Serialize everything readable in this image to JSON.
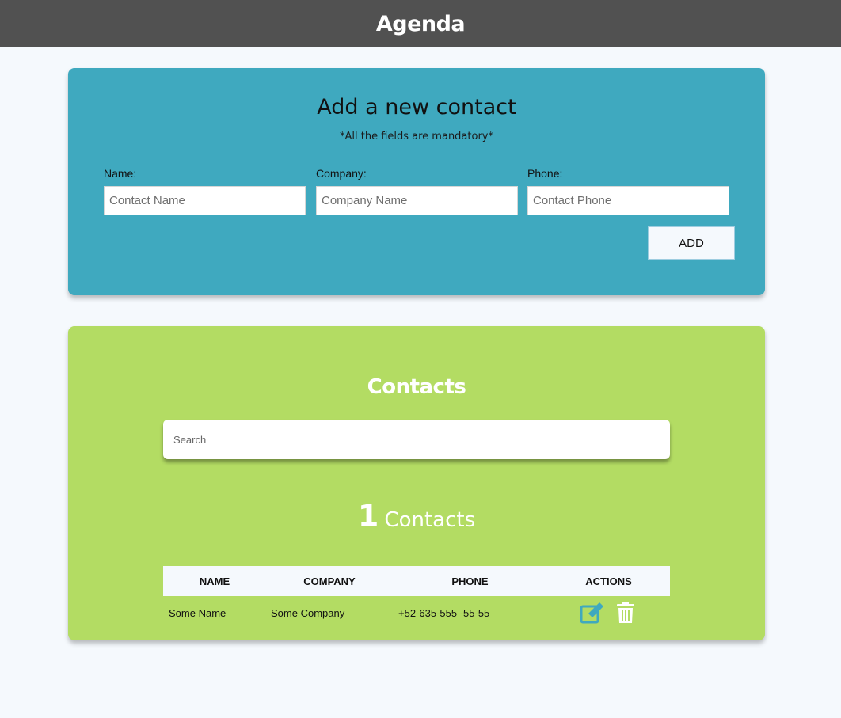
{
  "header": {
    "title": "Agenda"
  },
  "add_form": {
    "title": "Add a new contact",
    "subtitle": "*All the fields are mandatory*",
    "name_label": "Name:",
    "name_placeholder": "Contact Name",
    "company_label": "Company:",
    "company_placeholder": "Company Name",
    "phone_label": "Phone:",
    "phone_placeholder": "Contact Phone",
    "add_button": "ADD"
  },
  "contacts": {
    "title": "Contacts",
    "search_placeholder": "Search",
    "count": "1",
    "count_label": "Contacts",
    "columns": [
      "NAME",
      "COMPANY",
      "PHONE",
      "ACTIONS"
    ],
    "rows": [
      {
        "name": "Some Name",
        "company": "Some Company",
        "phone": "+52-635-555 -55-55"
      }
    ],
    "actions": {
      "edit_icon": "edit-icon",
      "delete_icon": "trash-icon"
    }
  },
  "colors": {
    "topbar": "#515151",
    "add_card": "#3fa9bf",
    "list_card": "#b3dc63",
    "background": "#f5f9fd",
    "edit_icon": "#3fa9bf",
    "delete_icon": "#ffffff"
  }
}
